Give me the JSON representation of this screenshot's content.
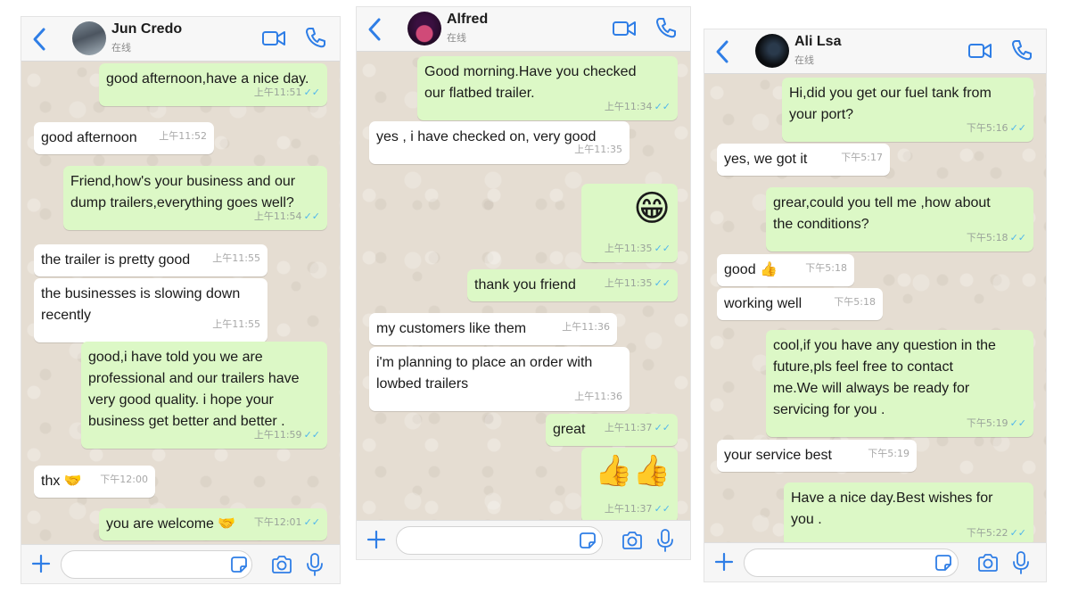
{
  "colors": {
    "accent": "#2f7ee6",
    "outgoing_bubble": "#dcf8c6",
    "incoming_bubble": "#ffffff",
    "read_ticks": "#4fb6ec",
    "chat_background": "#e5ddd2"
  },
  "icons": {
    "back": "chevron-left-icon",
    "video": "video-camera-icon",
    "call": "phone-icon",
    "attach": "plus-icon",
    "sticker": "sticker-icon",
    "camera": "camera-icon",
    "voice": "microphone-icon"
  },
  "chats": [
    {
      "contact": "Jun Credo",
      "status": "在线",
      "messages": [
        {
          "dir": "out",
          "text": "good afternoon,have a nice day.",
          "time": "上午11:51",
          "ticks": "✓✓"
        },
        {
          "dir": "in",
          "text": "good afternoon",
          "time": "上午11:52"
        },
        {
          "dir": "out",
          "text": "Friend,how's your business and our\ndump trailers,everything goes well?",
          "time": "上午11:54",
          "ticks": "✓✓"
        },
        {
          "dir": "in",
          "text": "the trailer is pretty good",
          "time": "上午11:55"
        },
        {
          "dir": "in",
          "text": "the businesses is slowing down\nrecently",
          "time": "上午11:55"
        },
        {
          "dir": "out",
          "text": "good,i have told you we are\nprofessional and our trailers have\nvery good quality. i hope your\nbusiness get better and better .",
          "time": "上午11:59",
          "ticks": "✓✓"
        },
        {
          "dir": "in",
          "text": "thx 🤝",
          "time": "下午12:00"
        },
        {
          "dir": "out",
          "text": "you are welcome 🤝",
          "time": "下午12:01",
          "ticks": "✓✓"
        }
      ]
    },
    {
      "contact": "Alfred",
      "status": "在线",
      "messages": [
        {
          "dir": "out",
          "text": "Good morning.Have you checked\nour flatbed trailer.",
          "time": "上午11:34",
          "ticks": "✓✓"
        },
        {
          "dir": "in",
          "text": "yes , i have checked on, very good",
          "time": "上午11:35"
        },
        {
          "dir": "out",
          "emoji": "😁",
          "time": "上午11:35",
          "ticks": "✓✓"
        },
        {
          "dir": "out",
          "text": "thank you friend",
          "time": "上午11:35",
          "ticks": "✓✓"
        },
        {
          "dir": "in",
          "text": "my customers like them",
          "time": "上午11:36"
        },
        {
          "dir": "in",
          "text": "i'm planning to place an order with\nlowbed trailers",
          "time": "上午11:36"
        },
        {
          "dir": "out",
          "text": "great",
          "time": "上午11:37",
          "ticks": "✓✓"
        },
        {
          "dir": "out",
          "emoji": "👍👍",
          "time": "上午11:37",
          "ticks": "✓✓"
        }
      ]
    },
    {
      "contact": "Ali Lsa",
      "status": "在线",
      "messages": [
        {
          "dir": "out",
          "text": "Hi,did you get our fuel tank from\nyour port?",
          "time": "下午5:16",
          "ticks": "✓✓"
        },
        {
          "dir": "in",
          "text": "yes, we got it",
          "time": "下午5:17"
        },
        {
          "dir": "out",
          "text": "grear,could you tell me ,how about\nthe conditions?",
          "time": "下午5:18",
          "ticks": "✓✓"
        },
        {
          "dir": "in",
          "text": "good 👍",
          "time": "下午5:18"
        },
        {
          "dir": "in",
          "text": "working well",
          "time": "下午5:18"
        },
        {
          "dir": "out",
          "text": "cool,if you have any question in the\nfuture,pls feel free to contact\nme.We will always be ready for\nservicing for you .",
          "time": "下午5:19",
          "ticks": "✓✓"
        },
        {
          "dir": "in",
          "text": "your service best",
          "time": "下午5:19"
        },
        {
          "dir": "out",
          "text": "Have a nice day.Best wishes for\nyou .",
          "time": "下午5:22",
          "ticks": "✓✓"
        }
      ]
    }
  ]
}
